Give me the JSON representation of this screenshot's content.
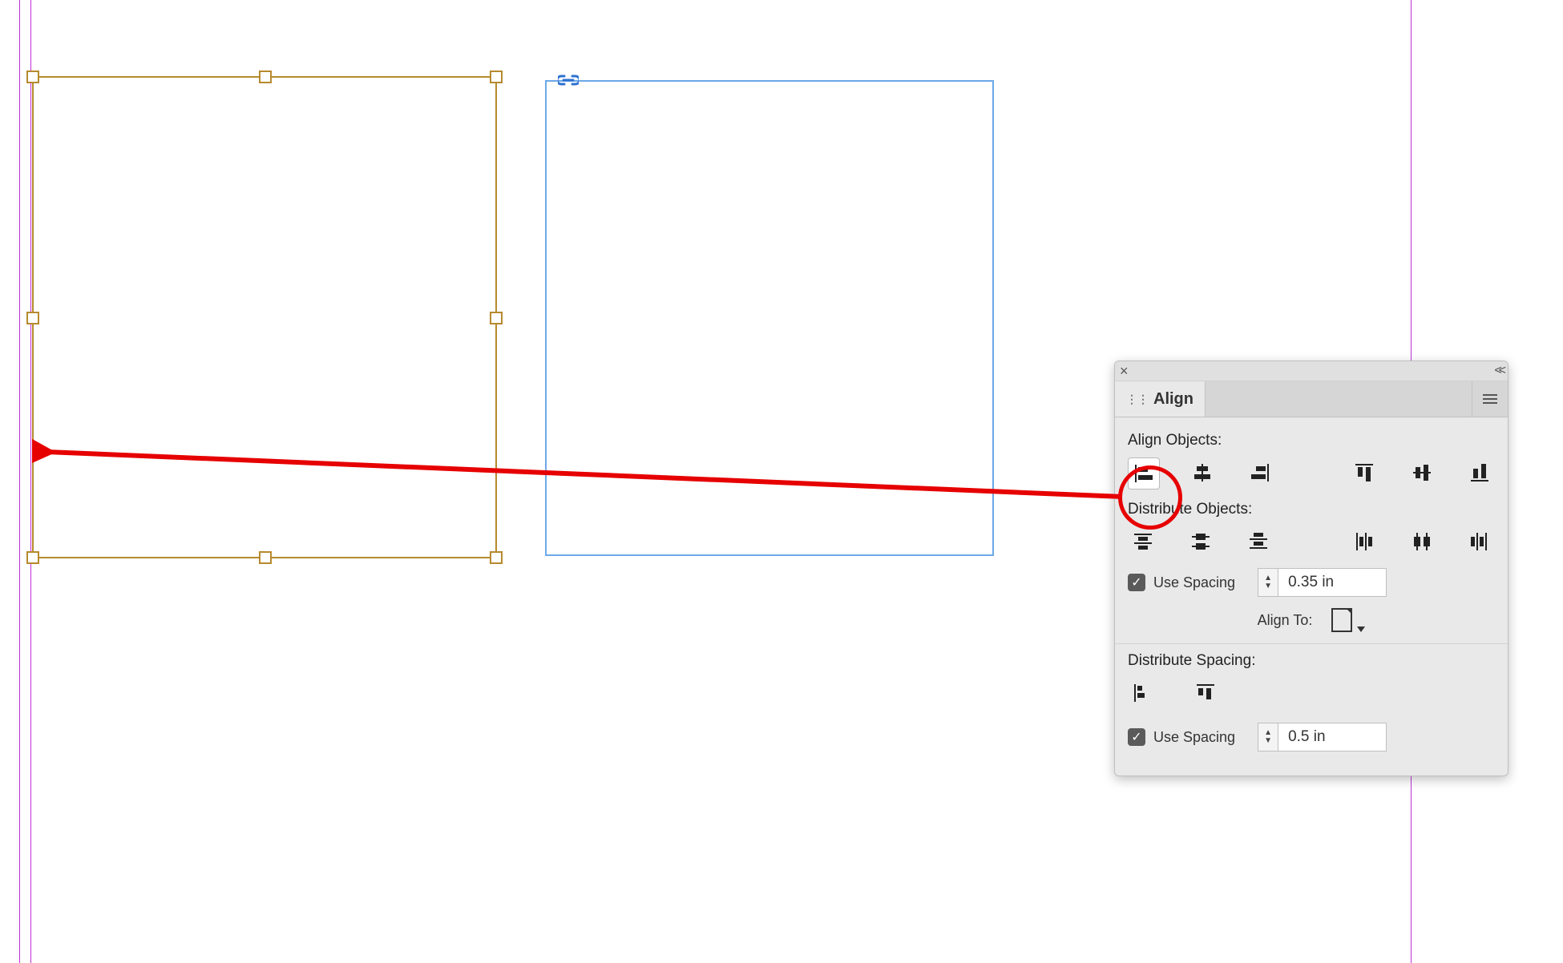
{
  "panel": {
    "tab_label": "Align",
    "sections": {
      "align_objects_label": "Align Objects:",
      "distribute_objects_label": "Distribute Objects:",
      "distribute_spacing_label": "Distribute Spacing:",
      "use_spacing_label_1": "Use Spacing",
      "use_spacing_label_2": "Use Spacing",
      "align_to_label": "Align To:"
    },
    "values": {
      "distribute_spacing_value": "0.35 in",
      "distribute_spacing2_value": "0.5 in",
      "use_spacing_1_checked": true,
      "use_spacing_2_checked": true
    }
  }
}
